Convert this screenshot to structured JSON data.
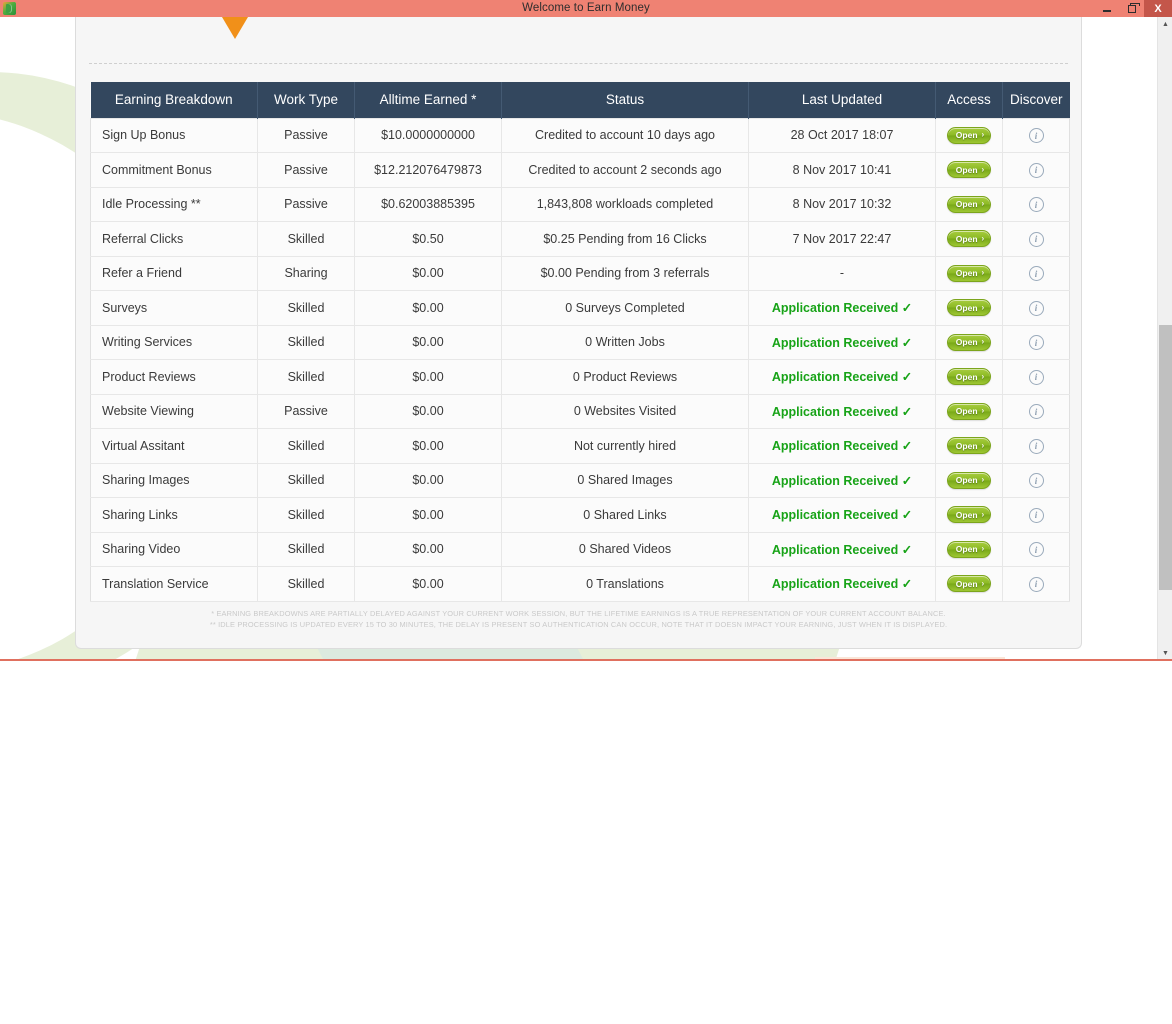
{
  "window": {
    "title": "Welcome to Earn Money",
    "app_icon": "app-leaf-icon",
    "controls": {
      "minimize": "minimize-icon",
      "maximize": "restore-icon",
      "close": "X"
    }
  },
  "table": {
    "headers": [
      "Earning Breakdown",
      "Work Type",
      "Alltime Earned *",
      "Status",
      "Last Updated",
      "Access",
      "Discover"
    ],
    "access_label": "Open",
    "access_arrow": "›",
    "discover_icon": "i",
    "rows": [
      {
        "name": "Sign Up Bonus",
        "work_type": "Passive",
        "earned": "$10.0000000000",
        "status": "Credited to account 10 days ago",
        "updated": "28 Oct 2017 18:07",
        "updated_state": "normal"
      },
      {
        "name": "Commitment Bonus",
        "work_type": "Passive",
        "earned": "$12.212076479873",
        "status": "Credited to account 2 seconds ago",
        "updated": "8 Nov 2017 10:41",
        "updated_state": "normal"
      },
      {
        "name": "Idle Processing **",
        "work_type": "Passive",
        "earned": "$0.62003885395",
        "status": "1,843,808 workloads completed",
        "updated": "8 Nov 2017 10:32",
        "updated_state": "normal"
      },
      {
        "name": "Referral Clicks",
        "work_type": "Skilled",
        "earned": "$0.50",
        "status": "$0.25 Pending from 16 Clicks",
        "updated": "7 Nov 2017 22:47",
        "updated_state": "normal"
      },
      {
        "name": "Refer a Friend",
        "work_type": "Sharing",
        "earned": "$0.00",
        "status": "$0.00 Pending from 3 referrals",
        "updated": "-",
        "updated_state": "normal"
      },
      {
        "name": "Surveys",
        "work_type": "Skilled",
        "earned": "$0.00",
        "status": "0 Surveys Completed",
        "updated": "Application Received ✓",
        "updated_state": "received"
      },
      {
        "name": "Writing Services",
        "work_type": "Skilled",
        "earned": "$0.00",
        "status": "0 Written Jobs",
        "updated": "Application Received ✓",
        "updated_state": "received"
      },
      {
        "name": "Product Reviews",
        "work_type": "Skilled",
        "earned": "$0.00",
        "status": "0 Product Reviews",
        "updated": "Application Received ✓",
        "updated_state": "received"
      },
      {
        "name": "Website Viewing",
        "work_type": "Passive",
        "earned": "$0.00",
        "status": "0 Websites Visited",
        "updated": "Application Received ✓",
        "updated_state": "received"
      },
      {
        "name": "Virtual Assitant",
        "work_type": "Skilled",
        "earned": "$0.00",
        "status": "Not currently hired",
        "updated": "Application Received ✓",
        "updated_state": "received"
      },
      {
        "name": "Sharing Images",
        "work_type": "Skilled",
        "earned": "$0.00",
        "status": "0 Shared Images",
        "updated": "Application Received ✓",
        "updated_state": "received"
      },
      {
        "name": "Sharing Links",
        "work_type": "Skilled",
        "earned": "$0.00",
        "status": "0 Shared Links",
        "updated": "Application Received ✓",
        "updated_state": "received"
      },
      {
        "name": "Sharing Video",
        "work_type": "Skilled",
        "earned": "$0.00",
        "status": "0 Shared Videos",
        "updated": "Application Received ✓",
        "updated_state": "received"
      },
      {
        "name": "Translation Service",
        "work_type": "Skilled",
        "earned": "$0.00",
        "status": "0 Translations",
        "updated": "Application Received ✓",
        "updated_state": "received"
      }
    ]
  },
  "footnotes": [
    "* EARNING BREAKDOWNS ARE PARTIALLY DELAYED AGAINST YOUR CURRENT WORK SESSION, BUT THE LIFETIME EARNINGS IS A TRUE REPRESENTATION OF YOUR CURRENT ACCOUNT BALANCE.",
    "** IDLE PROCESSING IS UPDATED EVERY 15 TO 30 MINUTES, THE DELAY IS PRESENT SO AUTHENTICATION CAN OCCUR, NOTE THAT IT DOESN IMPACT YOUR EARNING, JUST WHEN IT IS DISPLAYED."
  ],
  "scrollbar": {
    "up_arrow": "▲",
    "down_arrow": "▼"
  },
  "colors": {
    "titlebar": "#ef8273",
    "close_button": "#c4564a",
    "table_header": "#33475e",
    "accent_green": "#17a317",
    "caret_orange": "#f19019"
  }
}
